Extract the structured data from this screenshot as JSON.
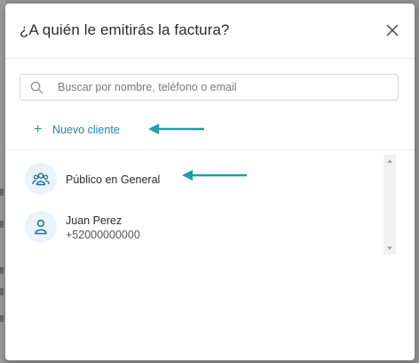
{
  "dialog": {
    "title": "¿A quién le emitirás la factura?"
  },
  "search": {
    "placeholder": "Buscar por nombre, teléfono o email",
    "value": ""
  },
  "new_client": {
    "label": "Nuevo cliente",
    "icon": "plus-icon"
  },
  "clients": [
    {
      "name": "Público en General",
      "phone": "",
      "icon": "group-icon"
    },
    {
      "name": "Juan Perez",
      "phone": "+52000000000",
      "icon": "person-icon"
    }
  ],
  "colors": {
    "accent": "#1f86a7",
    "arrow": "#1aa0a6",
    "avatar_bg": "#e9f3f9"
  }
}
